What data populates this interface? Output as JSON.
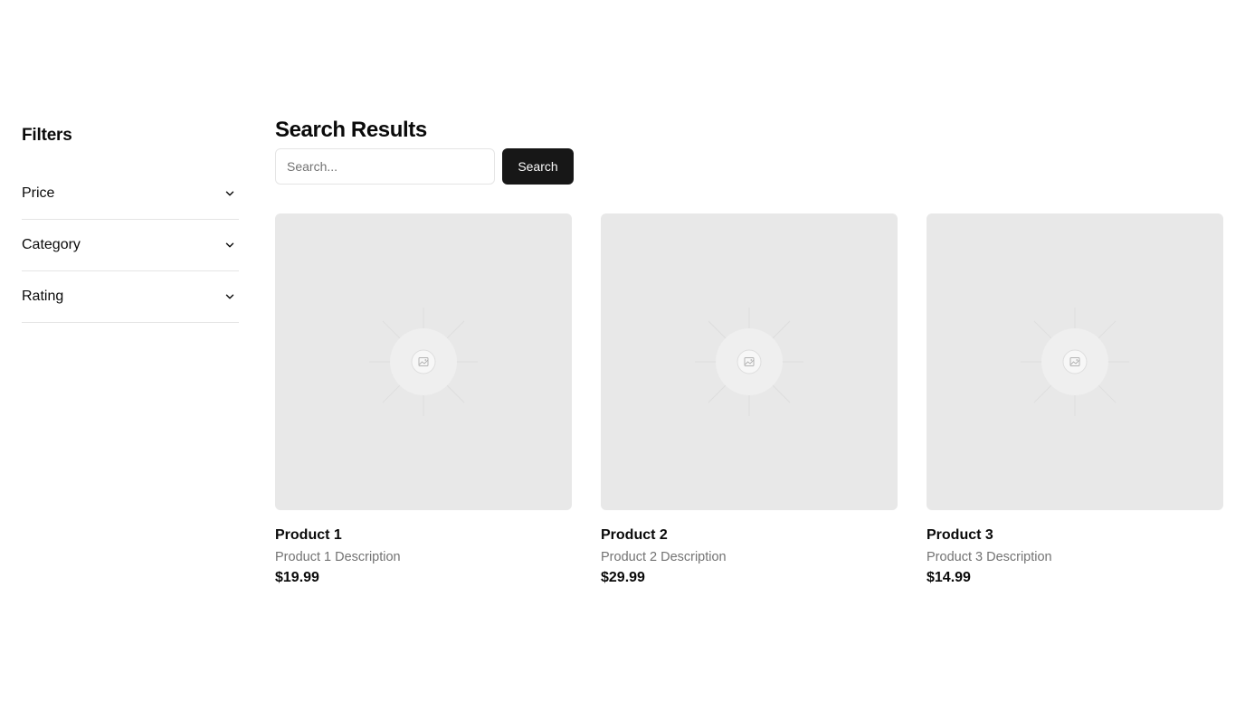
{
  "sidebar": {
    "title": "Filters",
    "filters": [
      {
        "label": "Price",
        "icon": "chevron-down-icon"
      },
      {
        "label": "Category",
        "icon": "chevron-down-icon"
      },
      {
        "label": "Rating",
        "icon": "chevron-down-icon"
      }
    ]
  },
  "main": {
    "title": "Search Results",
    "search": {
      "placeholder": "Search...",
      "value": "",
      "button_label": "Search"
    },
    "products": [
      {
        "name": "Product 1",
        "description": "Product 1 Description",
        "price": "$19.99",
        "image_icon": "image-placeholder-icon"
      },
      {
        "name": "Product 2",
        "description": "Product 2 Description",
        "price": "$29.99",
        "image_icon": "image-placeholder-icon"
      },
      {
        "name": "Product 3",
        "description": "Product 3 Description",
        "price": "$14.99",
        "image_icon": "image-placeholder-icon"
      }
    ]
  },
  "colors": {
    "button_bg": "#171717",
    "button_text": "#fafafa",
    "image_bg": "#e8e8e8",
    "muted_text": "#737373",
    "border": "#e5e5e5"
  }
}
